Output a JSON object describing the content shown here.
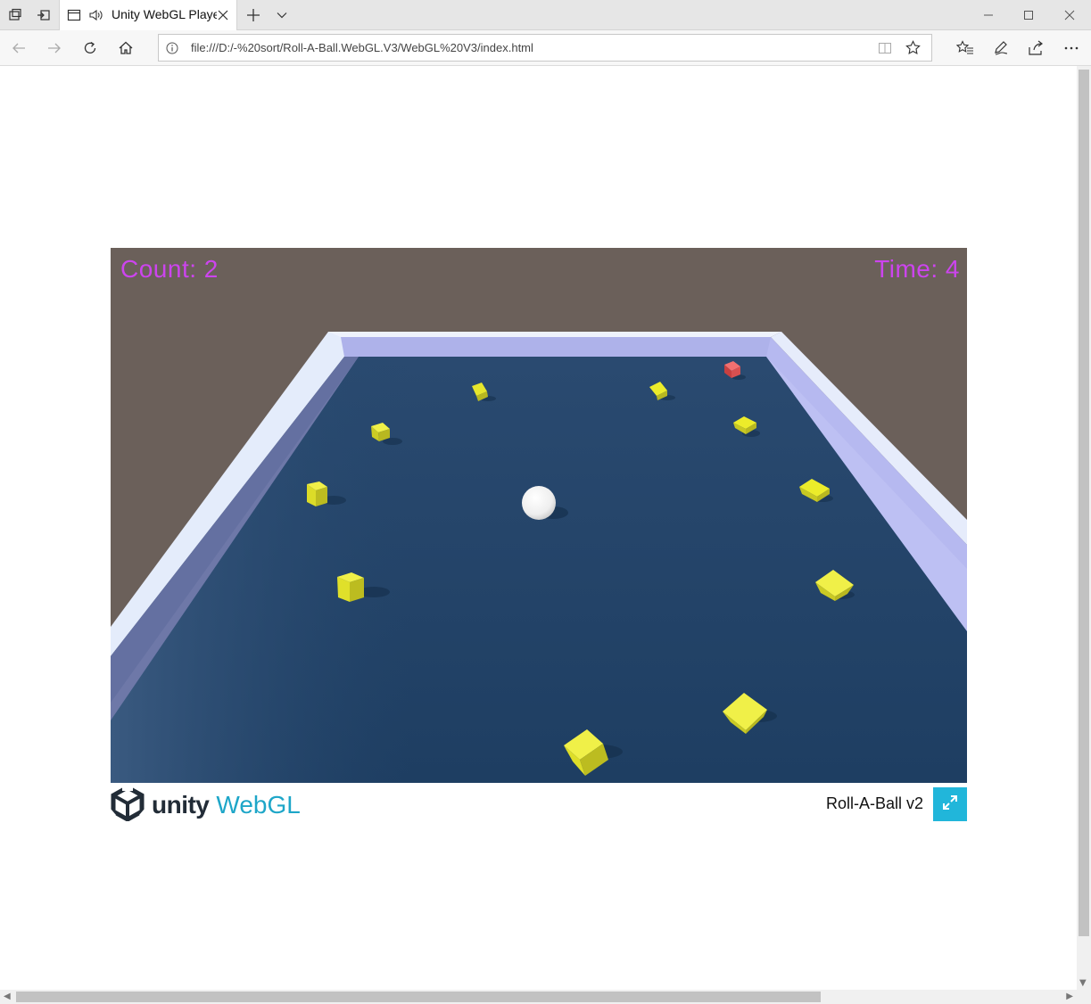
{
  "browser": {
    "tab": {
      "title": "Unity WebGL Player"
    },
    "address": {
      "url": "file:///D:/-%20sort/Roll-A-Ball.WebGL.V3/WebGL%20V3/index.html"
    }
  },
  "icons": {
    "tab-actions": "tabs-aside-icon",
    "back-tabs": "set-tabs-aside-icon",
    "favicon": "page-icon",
    "speaker": "speaker-icon",
    "close-tab": "close-icon",
    "new-tab": "plus-icon",
    "tab-list": "chevron-down-icon",
    "minimize": "minimize-icon",
    "maximize": "maximize-icon",
    "close-window": "close-icon",
    "back": "back-arrow-icon",
    "forward": "forward-arrow-icon",
    "refresh": "refresh-icon",
    "home": "home-icon",
    "info": "info-icon",
    "reading-view": "book-icon",
    "favorite": "star-icon",
    "favorites-hub": "favorites-list-icon",
    "notes": "pen-icon",
    "share": "share-icon",
    "more": "more-icon",
    "fullscreen": "fullscreen-icon"
  },
  "game": {
    "count_label": "Count: 2",
    "time_label": "Time: 4",
    "colors": {
      "hud": "#cc44ee",
      "floor": "#26476b",
      "pickup": "#ecec2a",
      "player_pickup_red": "#e04848",
      "background": "#6b605a"
    }
  },
  "footer": {
    "logo_unity": "unity",
    "logo_webgl": "WebGL",
    "title": "Roll-A-Ball v2",
    "fullscreen_color": "#21b6da"
  }
}
